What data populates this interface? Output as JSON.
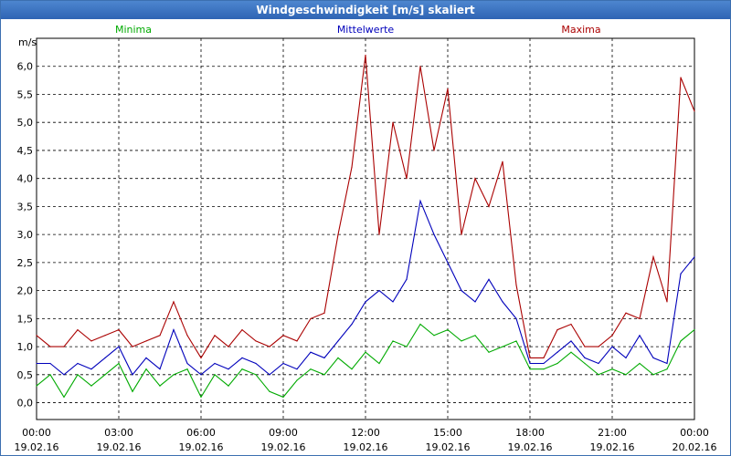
{
  "window": {
    "title": "Windgeschwindigkeit [m/s] skaliert"
  },
  "chart_data": {
    "type": "line",
    "title": "Windgeschwindigkeit [m/s] skaliert",
    "ylabel": "m/s",
    "ylim": [
      -0.3,
      6.5
    ],
    "xlim_hours": [
      0,
      24
    ],
    "y_ticks": [
      "0,0",
      "0,5",
      "1,0",
      "1,5",
      "2,0",
      "2,5",
      "3,0",
      "3,5",
      "4,0",
      "4,5",
      "5,0",
      "5,5",
      "6,0"
    ],
    "x_ticks": [
      {
        "time": "00:00",
        "date": "19.02.16"
      },
      {
        "time": "03:00",
        "date": "19.02.16"
      },
      {
        "time": "06:00",
        "date": "19.02.16"
      },
      {
        "time": "09:00",
        "date": "19.02.16"
      },
      {
        "time": "12:00",
        "date": "19.02.16"
      },
      {
        "time": "15:00",
        "date": "19.02.16"
      },
      {
        "time": "18:00",
        "date": "19.02.16"
      },
      {
        "time": "21:00",
        "date": "19.02.16"
      },
      {
        "time": "00:00",
        "date": "20.02.16"
      }
    ],
    "grid": true,
    "grid_style": "dashed",
    "legend_position": "top",
    "series": [
      {
        "name": "Minima",
        "color": "#00aa00",
        "x": [
          0,
          0.5,
          1,
          1.5,
          2,
          2.5,
          3,
          3.5,
          4,
          4.5,
          5,
          5.5,
          6,
          6.5,
          7,
          7.5,
          8,
          8.5,
          9,
          9.5,
          10,
          10.5,
          11,
          11.5,
          12,
          12.5,
          13,
          13.5,
          14,
          14.5,
          15,
          15.5,
          16,
          16.5,
          17,
          17.5,
          18,
          18.5,
          19,
          19.5,
          20,
          20.5,
          21,
          21.5,
          22,
          22.5,
          23,
          23.5,
          24
        ],
        "y": [
          0.3,
          0.5,
          0.1,
          0.5,
          0.3,
          0.5,
          0.7,
          0.2,
          0.6,
          0.3,
          0.5,
          0.6,
          0.1,
          0.5,
          0.3,
          0.6,
          0.5,
          0.2,
          0.1,
          0.4,
          0.6,
          0.5,
          0.8,
          0.6,
          0.9,
          0.7,
          1.1,
          1.0,
          1.4,
          1.2,
          1.3,
          1.1,
          1.2,
          0.9,
          1.0,
          1.1,
          0.6,
          0.6,
          0.7,
          0.9,
          0.7,
          0.5,
          0.6,
          0.5,
          0.7,
          0.5,
          0.6,
          1.1,
          1.3
        ]
      },
      {
        "name": "Mittelwerte",
        "color": "#0000bb",
        "x": [
          0,
          0.5,
          1,
          1.5,
          2,
          2.5,
          3,
          3.5,
          4,
          4.5,
          5,
          5.5,
          6,
          6.5,
          7,
          7.5,
          8,
          8.5,
          9,
          9.5,
          10,
          10.5,
          11,
          11.5,
          12,
          12.5,
          13,
          13.5,
          14,
          14.5,
          15,
          15.5,
          16,
          16.5,
          17,
          17.5,
          18,
          18.5,
          19,
          19.5,
          20,
          20.5,
          21,
          21.5,
          22,
          22.5,
          23,
          23.5,
          24
        ],
        "y": [
          0.7,
          0.7,
          0.5,
          0.7,
          0.6,
          0.8,
          1.0,
          0.5,
          0.8,
          0.6,
          1.3,
          0.7,
          0.5,
          0.7,
          0.6,
          0.8,
          0.7,
          0.5,
          0.7,
          0.6,
          0.9,
          0.8,
          1.1,
          1.4,
          1.8,
          2.0,
          1.8,
          2.2,
          3.6,
          3.0,
          2.5,
          2.0,
          1.8,
          2.2,
          1.8,
          1.5,
          0.7,
          0.7,
          0.9,
          1.1,
          0.8,
          0.7,
          1.0,
          0.8,
          1.2,
          0.8,
          0.7,
          2.3,
          2.6
        ]
      },
      {
        "name": "Maxima",
        "color": "#aa0000",
        "x": [
          0,
          0.5,
          1,
          1.5,
          2,
          2.5,
          3,
          3.5,
          4,
          4.5,
          5,
          5.5,
          6,
          6.5,
          7,
          7.5,
          8,
          8.5,
          9,
          9.5,
          10,
          10.5,
          11,
          11.5,
          12,
          12.5,
          13,
          13.5,
          14,
          14.5,
          15,
          15.5,
          16,
          16.5,
          17,
          17.5,
          18,
          18.5,
          19,
          19.5,
          20,
          20.5,
          21,
          21.5,
          22,
          22.5,
          23,
          23.5,
          24
        ],
        "y": [
          1.2,
          1.0,
          1.0,
          1.3,
          1.1,
          1.2,
          1.3,
          1.0,
          1.1,
          1.2,
          1.8,
          1.2,
          0.8,
          1.2,
          1.0,
          1.3,
          1.1,
          1.0,
          1.2,
          1.1,
          1.5,
          1.6,
          3.0,
          4.2,
          6.2,
          3.0,
          5.0,
          4.0,
          6.0,
          4.5,
          5.6,
          3.0,
          4.0,
          3.5,
          4.3,
          2.1,
          0.8,
          0.8,
          1.3,
          1.4,
          1.0,
          1.0,
          1.2,
          1.6,
          1.5,
          2.6,
          1.8,
          5.8,
          5.2
        ]
      }
    ]
  }
}
